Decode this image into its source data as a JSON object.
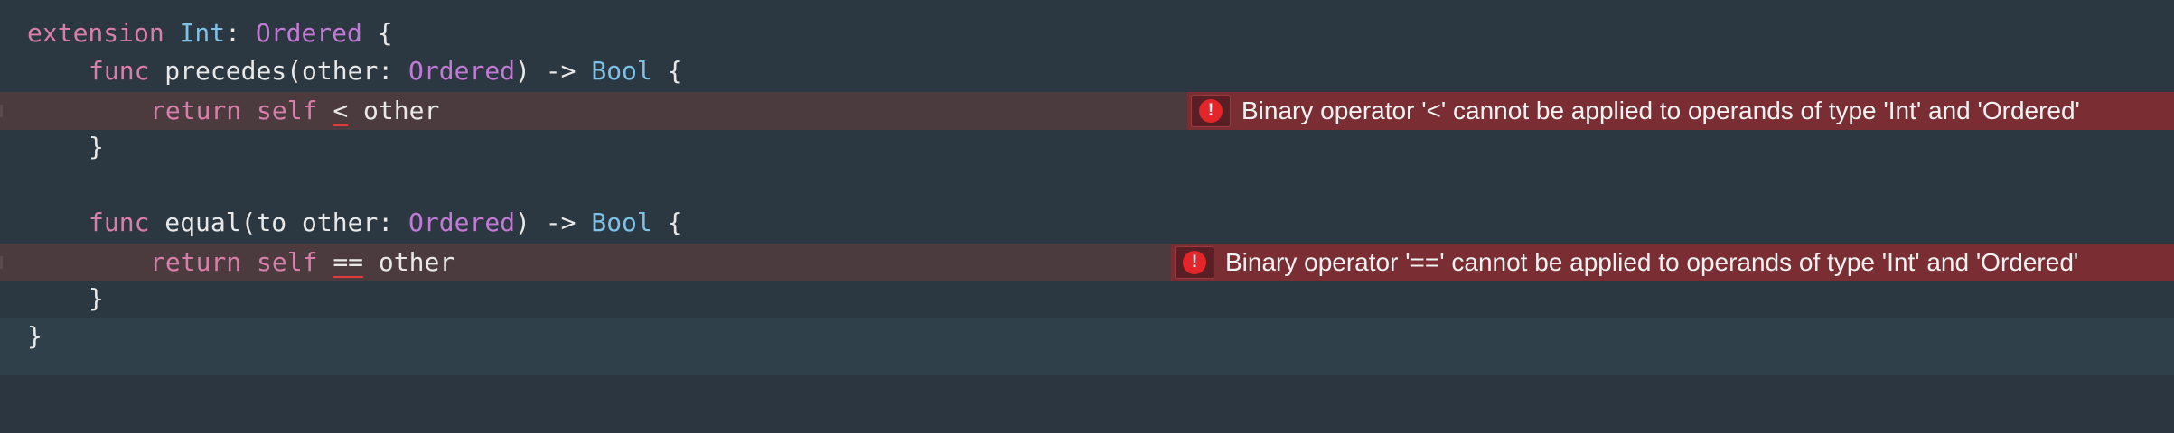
{
  "code": {
    "line1": {
      "kw": "extension",
      "type": "Int",
      "colon": ":",
      "proto": "Ordered",
      "brace": "{"
    },
    "line2": {
      "kw": "func",
      "name": "precedes(other:",
      "proto": "Ordered",
      "arrow": ") ->",
      "type": "Bool",
      "brace": "{"
    },
    "line3": {
      "kw_return": "return",
      "kw_self": "self",
      "op": "<",
      "rest": "other"
    },
    "line4": {
      "brace": "}"
    },
    "line6": {
      "kw": "func",
      "name": "equal(to other:",
      "proto": "Ordered",
      "arrow": ") ->",
      "type": "Bool",
      "brace": "{"
    },
    "line7": {
      "kw_return": "return",
      "kw_self": "self",
      "op": "==",
      "rest": "other"
    },
    "line8": {
      "brace": "}"
    },
    "line9": {
      "brace": "}"
    }
  },
  "errors": {
    "error1": {
      "icon": "!",
      "message": "Binary operator '<' cannot be applied to operands of type 'Int' and 'Ordered'"
    },
    "error2": {
      "icon": "!",
      "message": "Binary operator '==' cannot be applied to operands of type 'Int' and 'Ordered'"
    }
  },
  "colors": {
    "background": "#2c3841",
    "keyword": "#d77fa8",
    "type": "#7fc1e6",
    "protocol": "#c27ad6",
    "error_banner": "#7a2e33",
    "error_line": "#4b3b3f",
    "error_icon": "#e4262b"
  }
}
